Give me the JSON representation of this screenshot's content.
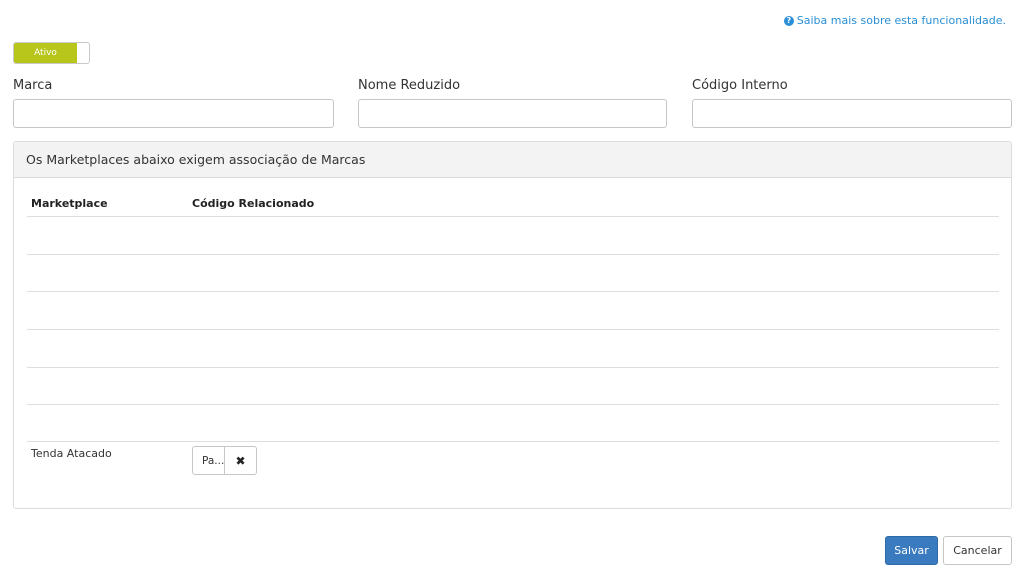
{
  "help": {
    "text": "Saiba mais sobre esta funcionalidade.",
    "icon": "question-circle-icon"
  },
  "status_toggle": {
    "label": "Ativo",
    "color": "#b8c51a"
  },
  "form": {
    "marca": {
      "label": "Marca",
      "value": "",
      "placeholder": ""
    },
    "nome_reduzido": {
      "label": "Nome Reduzido",
      "value": "",
      "placeholder": ""
    },
    "codigo_interno": {
      "label": "Código Interno",
      "value": "",
      "placeholder": ""
    }
  },
  "marketplaces": {
    "heading": "Os Marketplaces abaixo exigem associação de Marcas",
    "columns": [
      "Marketplace",
      "Código Relacionado"
    ],
    "rows": [
      {
        "marketplace": "Tenda Atacado",
        "code": "Pa..."
      }
    ]
  },
  "actions": {
    "save": "Salvar",
    "cancel": "Cancelar",
    "accent": "#3a7bbf"
  }
}
